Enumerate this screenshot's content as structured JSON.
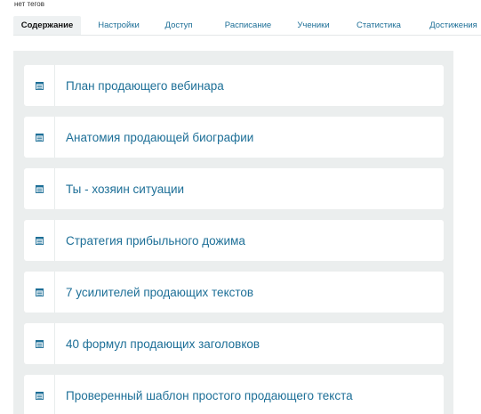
{
  "header": {
    "tags_text": "нет тегов"
  },
  "tabs": [
    {
      "label": "Содержание",
      "active": true
    },
    {
      "label": "Настройки",
      "active": false
    },
    {
      "label": "Доступ",
      "active": false
    },
    {
      "label": "Расписание",
      "active": false
    },
    {
      "label": "Ученики",
      "active": false
    },
    {
      "label": "Статистика",
      "active": false
    },
    {
      "label": "Достижения",
      "active": false
    }
  ],
  "lessons": [
    {
      "title": "План продающего вебинара",
      "icon": "document-icon"
    },
    {
      "title": "Анатомия продающей биографии",
      "icon": "document-icon"
    },
    {
      "title": "Ты - хозяин ситуации",
      "icon": "document-icon"
    },
    {
      "title": "Стратегия прибыльного дожима",
      "icon": "document-icon"
    },
    {
      "title": "7 усилителей продающих текстов",
      "icon": "document-icon"
    },
    {
      "title": "40 формул продающих заголовков",
      "icon": "document-icon"
    },
    {
      "title": "Проверенный шаблон простого продающего текста",
      "icon": "document-icon"
    }
  ],
  "colors": {
    "accent": "#1d6f97",
    "content_bg": "#ebeeee",
    "active_tab_bg": "#eef1f2"
  }
}
